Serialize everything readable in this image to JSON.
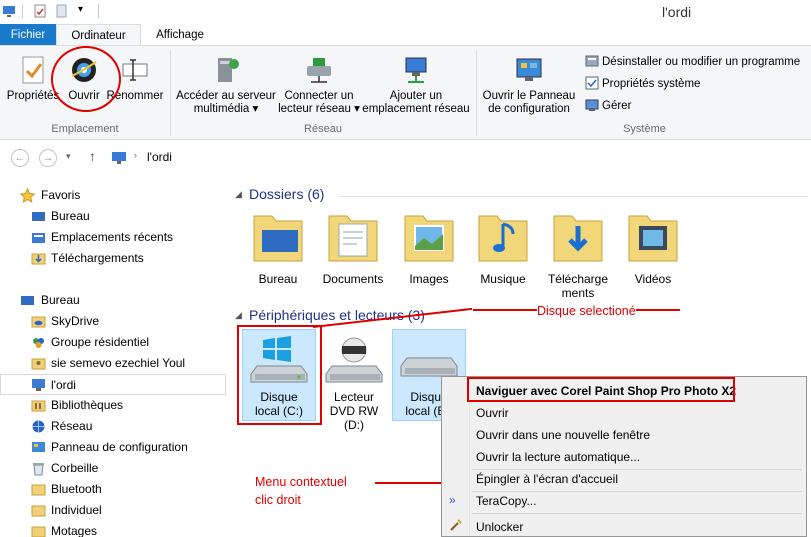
{
  "window": {
    "title": "l'ordi"
  },
  "tabs": [
    {
      "label": "Fichier"
    },
    {
      "label": "Ordinateur"
    },
    {
      "label": "Affichage"
    }
  ],
  "ribbon": {
    "emplacement": {
      "group_label": "Emplacement",
      "buttons": [
        {
          "label": "Propriétés",
          "icon": "properties-icon"
        },
        {
          "label": "Ouvrir",
          "icon": "open-icon"
        },
        {
          "label": "Renommer",
          "icon": "rename-icon"
        }
      ]
    },
    "reseau": {
      "group_label": "Réseau",
      "buttons": [
        {
          "label_line1": "Accéder au serveur",
          "label_line2": "multimédia ▾",
          "icon": "media-server-icon"
        },
        {
          "label_line1": "Connecter un",
          "label_line2": "lecteur réseau ▾",
          "icon": "map-drive-icon"
        },
        {
          "label_line1": "Ajouter un",
          "label_line2": "emplacement réseau",
          "icon": "network-location-icon"
        }
      ]
    },
    "systeme": {
      "group_label": "Système",
      "big_button": {
        "label_line1": "Ouvrir le Panneau",
        "label_line2": "de configuration",
        "icon": "control-panel-icon"
      },
      "small_buttons": [
        {
          "label": "Désinstaller ou modifier un programme",
          "icon": "uninstall-icon"
        },
        {
          "label": "Propriétés système",
          "icon": "system-properties-icon"
        },
        {
          "label": "Gérer",
          "icon": "manage-icon"
        }
      ]
    }
  },
  "address_bar": {
    "path": "l'ordi"
  },
  "sidebar": {
    "items": [
      {
        "label": "Favoris",
        "icon": "star-icon"
      },
      {
        "label": "Bureau",
        "icon": "desktop-icon"
      },
      {
        "label": "Emplacements récents",
        "icon": "recent-icon"
      },
      {
        "label": "Téléchargements",
        "icon": "downloads-icon"
      },
      {
        "label": "Bureau",
        "icon": "desktop-icon"
      },
      {
        "label": "SkyDrive",
        "icon": "skydrive-icon"
      },
      {
        "label": "Groupe résidentiel",
        "icon": "homegroup-icon"
      },
      {
        "label": "sie semevo ezechiel Youl",
        "icon": "user-folder-icon"
      },
      {
        "label": "l'ordi",
        "icon": "computer-icon"
      },
      {
        "label": "Bibliothèques",
        "icon": "libraries-icon"
      },
      {
        "label": "Réseau",
        "icon": "network-icon"
      },
      {
        "label": "Panneau de configuration",
        "icon": "control-panel-icon"
      },
      {
        "label": "Corbeille",
        "icon": "recycle-bin-icon"
      },
      {
        "label": "Bluetooth",
        "icon": "folder-icon"
      },
      {
        "label": "Individuel",
        "icon": "folder-icon"
      },
      {
        "label": "Motages",
        "icon": "folder-icon"
      }
    ]
  },
  "content": {
    "folders_header": "Dossiers (6)",
    "folders": [
      {
        "label": "Bureau"
      },
      {
        "label": "Documents"
      },
      {
        "label": "Images"
      },
      {
        "label": "Musique"
      },
      {
        "label_line1": "Télécharge",
        "label_line2": "ments"
      },
      {
        "label": "Vidéos"
      }
    ],
    "devices_header": "Périphériques et lecteurs (3)",
    "drives": [
      {
        "label_line1": "Disque",
        "label_line2": "local (C:)"
      },
      {
        "label_line1": "Lecteur",
        "label_line2": "DVD RW",
        "label_line3": "(D:)"
      },
      {
        "label_line1": "Disque",
        "label_line2": "local (E:)"
      }
    ]
  },
  "annotations": {
    "disk_selected": "Disque selectioné",
    "context_menu_line1": "Menu contextuel",
    "context_menu_line2": "clic droit"
  },
  "context_menu": {
    "items": [
      {
        "label": "Naviguer avec Corel Paint Shop Pro Photo X2"
      },
      {
        "label": "Ouvrir"
      },
      {
        "label": "Ouvrir dans une nouvelle fenêtre"
      },
      {
        "label": "Ouvrir la lecture automatique..."
      },
      {
        "label": "Épingler à l'écran d'accueil"
      },
      {
        "label": "TeraCopy..."
      },
      {
        "label": "Unlocker"
      }
    ]
  },
  "colors": {
    "accent": "#1979ca",
    "annotation": "#e00000",
    "selection": "#cce8ff"
  }
}
